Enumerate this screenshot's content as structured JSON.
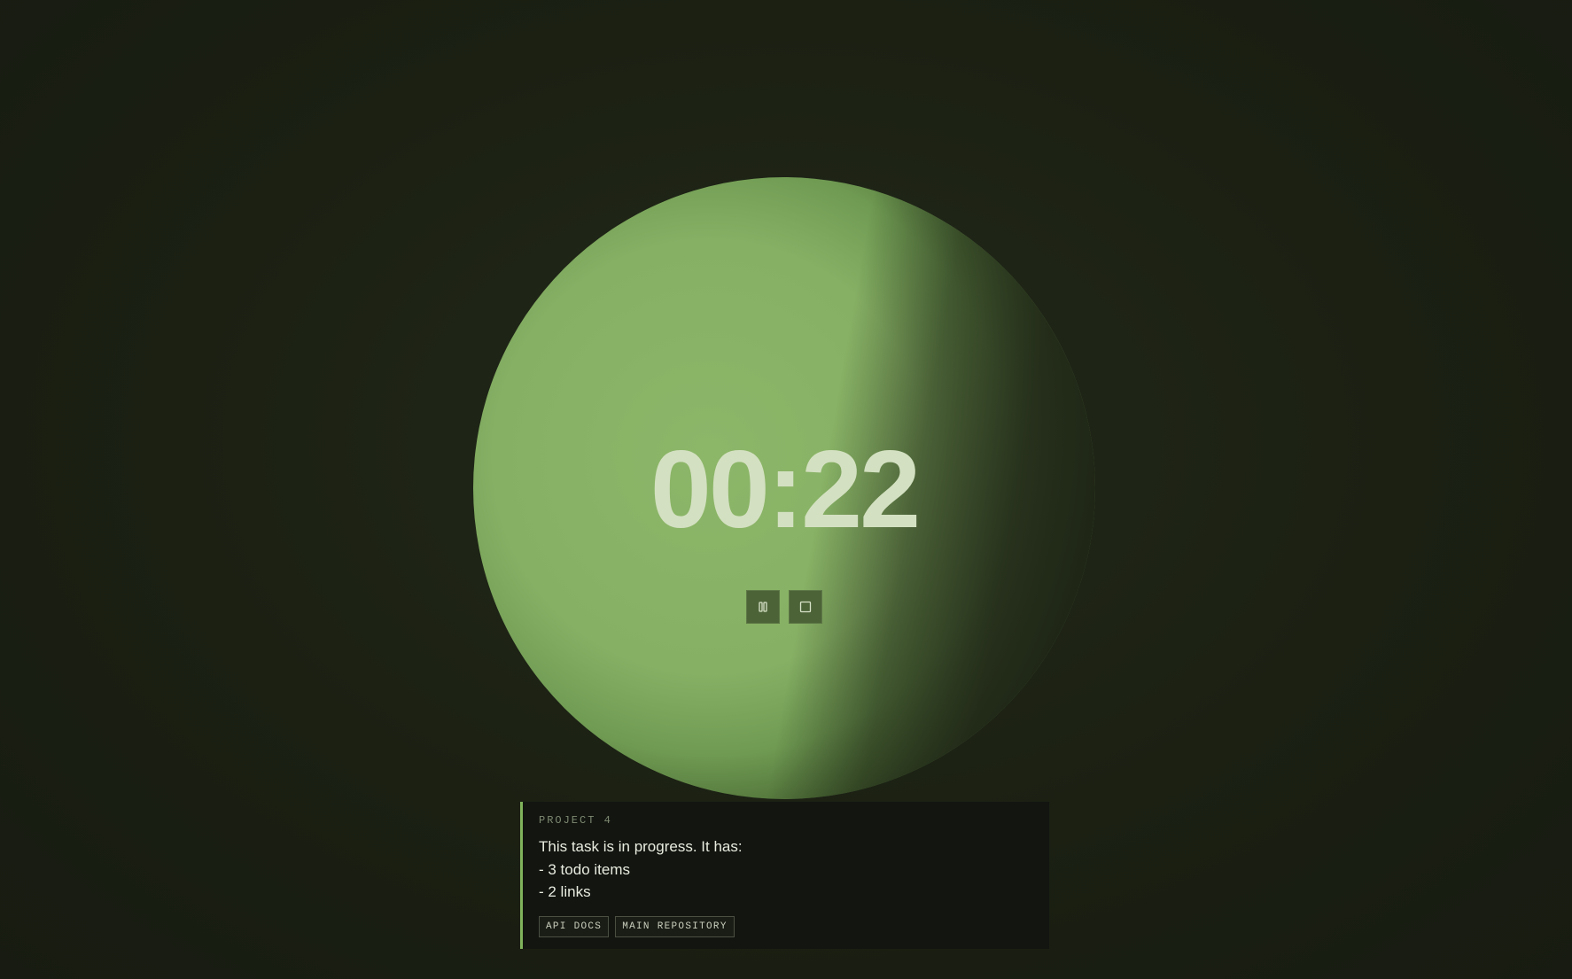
{
  "timer": {
    "display": "00:22"
  },
  "controls": {
    "pause_icon": "pause-icon",
    "stop_icon": "stop-icon"
  },
  "task_card": {
    "project_label": "PROJECT 4",
    "description_lines": [
      "This task is in progress. It has:",
      "- 3 todo items",
      "- 2 links"
    ],
    "links": [
      "API DOCS",
      "MAIN REPOSITORY"
    ]
  },
  "colors": {
    "background": "#1c2114",
    "orb": "#86b064",
    "timer_text": "#d3e0c1",
    "card_accent": "#7fb25a",
    "card_background": "#121510"
  }
}
